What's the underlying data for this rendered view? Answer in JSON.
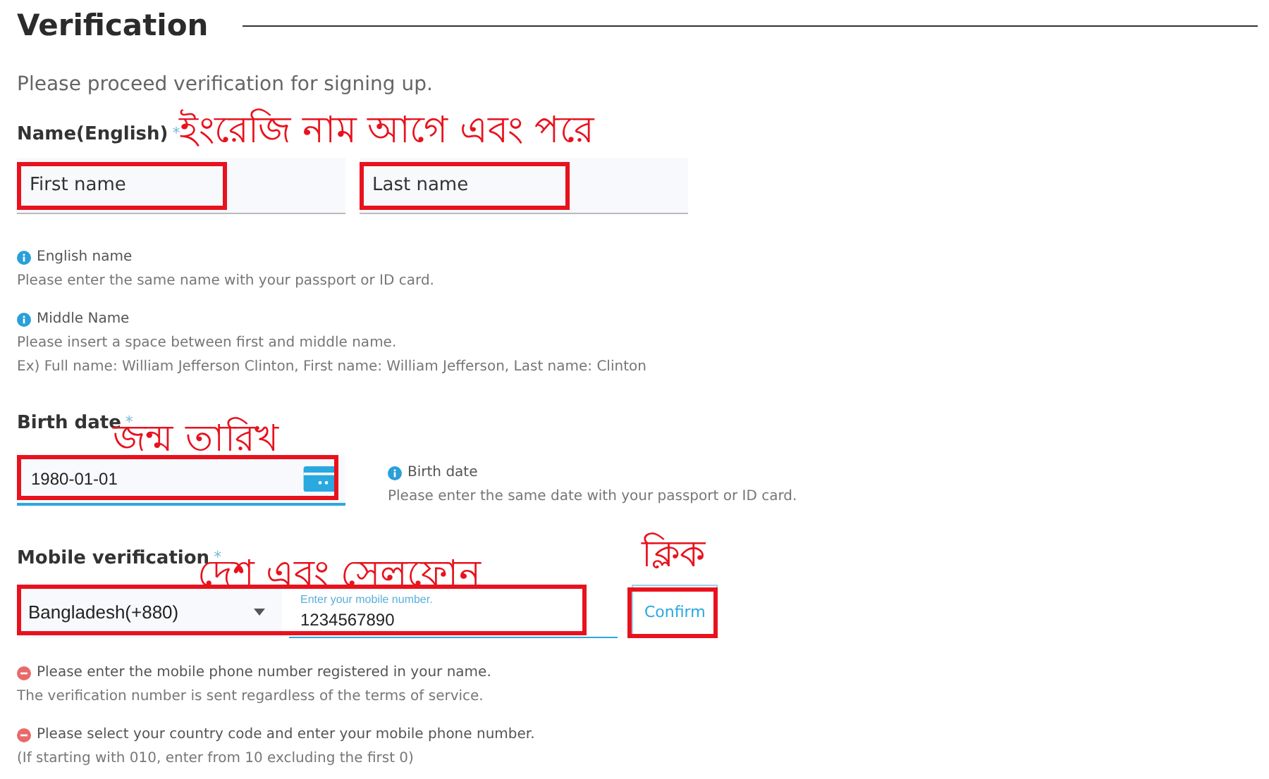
{
  "heading": "Verification",
  "intro": "Please proceed verification for signing up.",
  "name_section": {
    "label": "Name(English)",
    "required_mark": "*",
    "annotation": "ইংরেজি নাম আগে এবং পরে",
    "fields": [
      {
        "placeholder": "First name",
        "highlighted": true
      },
      {
        "placeholder": "Last name",
        "highlighted": true
      }
    ],
    "notes": [
      {
        "kind": "info",
        "title": "English name",
        "lines": [
          "Please enter the same name with your passport or ID card."
        ]
      },
      {
        "kind": "info",
        "title": "Middle Name",
        "lines": [
          "Please insert a space between first and middle name.",
          "Ex) Full name: William Jefferson Clinton, First name: William Jefferson, Last name: Clinton"
        ]
      }
    ]
  },
  "birth_section": {
    "label": "Birth date",
    "required_mark": "*",
    "annotation": "জন্ম তারিখ",
    "value": "1980-01-01",
    "highlighted": true,
    "note": {
      "kind": "info",
      "title": "Birth date",
      "lines": [
        "Please enter the same date with your passport or ID card."
      ]
    }
  },
  "mobile_section": {
    "label": "Mobile verification",
    "required_mark": "*",
    "annotation": "দেশ এবং সেলফোন",
    "highlighted": true,
    "country": "Bangladesh(+880)",
    "phone_label": "Enter your mobile number.",
    "phone": "1234567890",
    "confirm": {
      "label": "Confirm",
      "highlighted": true,
      "annotation": "ক্লিক"
    },
    "notes": [
      {
        "kind": "warning",
        "title": "Please enter the mobile phone number registered in your name.",
        "lines": [
          "The verification number is sent regardless of the terms of service."
        ]
      },
      {
        "kind": "warning",
        "title": "Please select your country code and enter your mobile phone number.",
        "lines": [
          "(If starting with 010, enter from 10 excluding the first 0)"
        ]
      }
    ]
  }
}
